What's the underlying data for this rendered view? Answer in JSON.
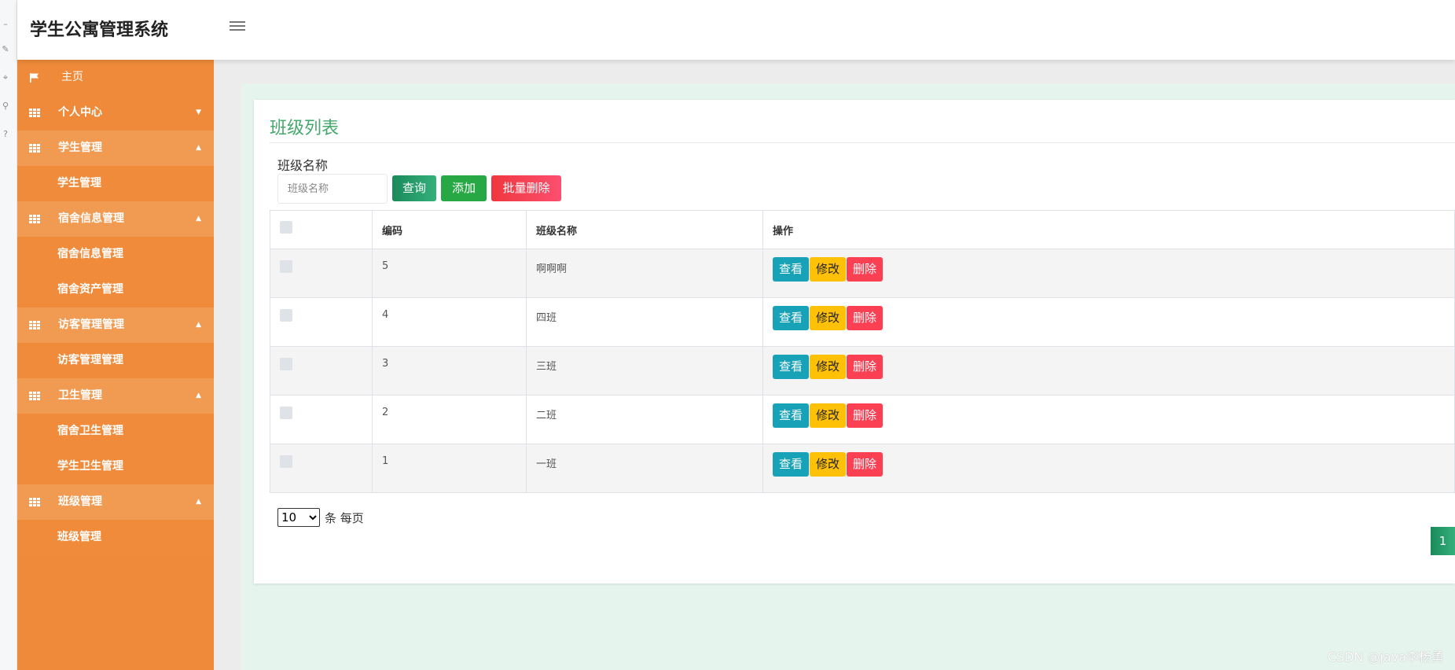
{
  "app": {
    "title": "学生公寓管理系统"
  },
  "sidebar": {
    "home": {
      "label": "主页"
    },
    "groups": [
      {
        "label": "个人中心",
        "items": []
      },
      {
        "label": "学生管理",
        "items": [
          "学生管理"
        ]
      },
      {
        "label": "宿舍信息管理",
        "items": [
          "宿舍信息管理",
          "宿舍资产管理"
        ]
      },
      {
        "label": "访客管理管理",
        "items": [
          "访客管理管理"
        ]
      },
      {
        "label": "卫生管理",
        "items": [
          "宿舍卫生管理",
          "学生卫生管理"
        ]
      },
      {
        "label": "班级管理",
        "items": [
          "班级管理"
        ]
      }
    ]
  },
  "page": {
    "title": "班级列表",
    "search": {
      "label": "班级名称",
      "placeholder": "班级名称",
      "value": ""
    },
    "buttons": {
      "query": "查询",
      "add": "添加",
      "batch_delete": "批量删除"
    },
    "table": {
      "headers": [
        "",
        "编码",
        "班级名称",
        "操作"
      ],
      "rows": [
        {
          "code": "5",
          "name": "啊啊啊"
        },
        {
          "code": "4",
          "name": "四班"
        },
        {
          "code": "3",
          "name": "三班"
        },
        {
          "code": "2",
          "name": "二班"
        },
        {
          "code": "1",
          "name": "一班"
        }
      ],
      "actions": {
        "view": "查看",
        "edit": "修改",
        "delete": "删除"
      }
    },
    "pagination": {
      "page_size": "10",
      "page_size_options": [
        "10"
      ],
      "suffix": "条 每页",
      "current_page": "1"
    }
  },
  "watermark": "CSDN @java李杨勇",
  "colors": {
    "sidebar": "#ee8a39",
    "title_green": "#45a86d",
    "view": "#17a2b8",
    "edit": "#ffc107",
    "delete": "#fb4054"
  }
}
